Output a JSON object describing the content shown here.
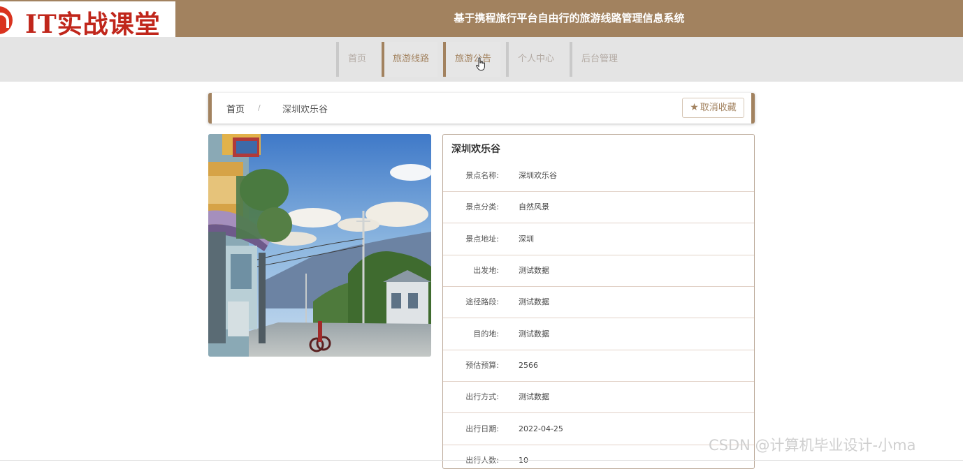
{
  "header": {
    "logo_text": "IT实战课堂",
    "site_title": "基于携程旅行平台自由行的旅游线路管理信息系统"
  },
  "nav": {
    "items": [
      {
        "label": "首页"
      },
      {
        "label": "旅游线路"
      },
      {
        "label": "旅游公告"
      },
      {
        "label": "个人中心"
      },
      {
        "label": "后台管理"
      }
    ]
  },
  "breadcrumb": {
    "home": "首页",
    "separator": "/",
    "current": "深圳欢乐谷"
  },
  "favorite_button": {
    "label": "取消收藏"
  },
  "detail": {
    "title": "深圳欢乐谷",
    "rows": [
      {
        "label": "景点名称:",
        "value": "深圳欢乐谷"
      },
      {
        "label": "景点分类:",
        "value": "自然风景"
      },
      {
        "label": "景点地址:",
        "value": "深圳"
      },
      {
        "label": "出发地:",
        "value": "测试数据"
      },
      {
        "label": "途径路段:",
        "value": "测试数据"
      },
      {
        "label": "目的地:",
        "value": "测试数据"
      },
      {
        "label": "预估预算:",
        "value": "2566"
      },
      {
        "label": "出行方式:",
        "value": "测试数据"
      },
      {
        "label": "出行日期:",
        "value": "2022-04-25"
      },
      {
        "label": "出行人数:",
        "value": "10"
      }
    ]
  },
  "watermark": "CSDN @计算机毕业设计-小ma",
  "colors": {
    "brand": "#a2825f",
    "logo_red": "#c0261b",
    "nav_bg": "#e4e4e4"
  }
}
